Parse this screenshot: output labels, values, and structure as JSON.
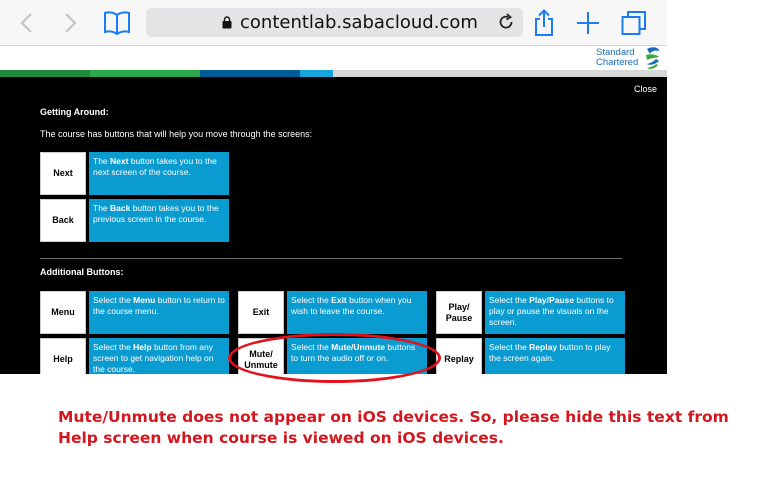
{
  "browser": {
    "url": "contentlab.sabacloud.com",
    "icons": [
      "back-arrow-icon",
      "forward-arrow-icon",
      "bookmarks-icon",
      "lock-icon",
      "reload-icon",
      "share-icon",
      "new-tab-icon",
      "tabs-icon"
    ]
  },
  "brand": {
    "line1": "Standard",
    "line2": "Chartered",
    "colors": {
      "blue": "#1b6db5",
      "green": "#3aa935"
    }
  },
  "stripe_colors": [
    "#1e8a3a",
    "#2aa84a",
    "#005a93",
    "#0a7cc2",
    "#17a6dc",
    "#d0d0d0"
  ],
  "panel": {
    "close_label": "Close",
    "getting_around_title": "Getting Around:",
    "getting_around_intro": "The course has buttons that will help you move through the screens:",
    "nav_buttons": [
      {
        "label": "Next",
        "desc_bold": "Next",
        "desc_pre": "The ",
        "desc_post": " button takes you to the next screen of the course."
      },
      {
        "label": "Back",
        "desc_bold": "Back",
        "desc_pre": "The ",
        "desc_post": " button takes you to the previous screen in the course."
      }
    ],
    "additional_title": "Additional Buttons:",
    "additional_buttons": [
      {
        "label": "Menu",
        "desc_pre": "Select the ",
        "desc_bold": "Menu",
        "desc_post": " button to return to the course menu."
      },
      {
        "label": "Exit",
        "desc_pre": "Select the ",
        "desc_bold": "Exit",
        "desc_post": " button when you wish to leave the course."
      },
      {
        "label_1": "Play/",
        "label_2": "Pause",
        "desc_pre": "Select the ",
        "desc_bold": "Play/Pause",
        "desc_post": " buttons to play or pause the visuals on the screen."
      },
      {
        "label": "Help",
        "desc_pre": "Select the ",
        "desc_bold": "Help",
        "desc_post": " button from any screen to get navigation help on the course."
      },
      {
        "label_1": "Mute/",
        "label_2": "Unmute",
        "desc_pre": "Select the ",
        "desc_bold": "Mute/Unmute",
        "desc_post": " buttons to turn the audio off or on."
      },
      {
        "label": "Replay",
        "desc_pre": "Select the ",
        "desc_bold": "Replay",
        "desc_post": " button to play the screen again."
      }
    ]
  },
  "annotation": {
    "note": "Mute/Unmute does not appear on iOS devices. So, please hide this text from Help screen when course is viewed on iOS devices.",
    "color": "#d2171f"
  }
}
